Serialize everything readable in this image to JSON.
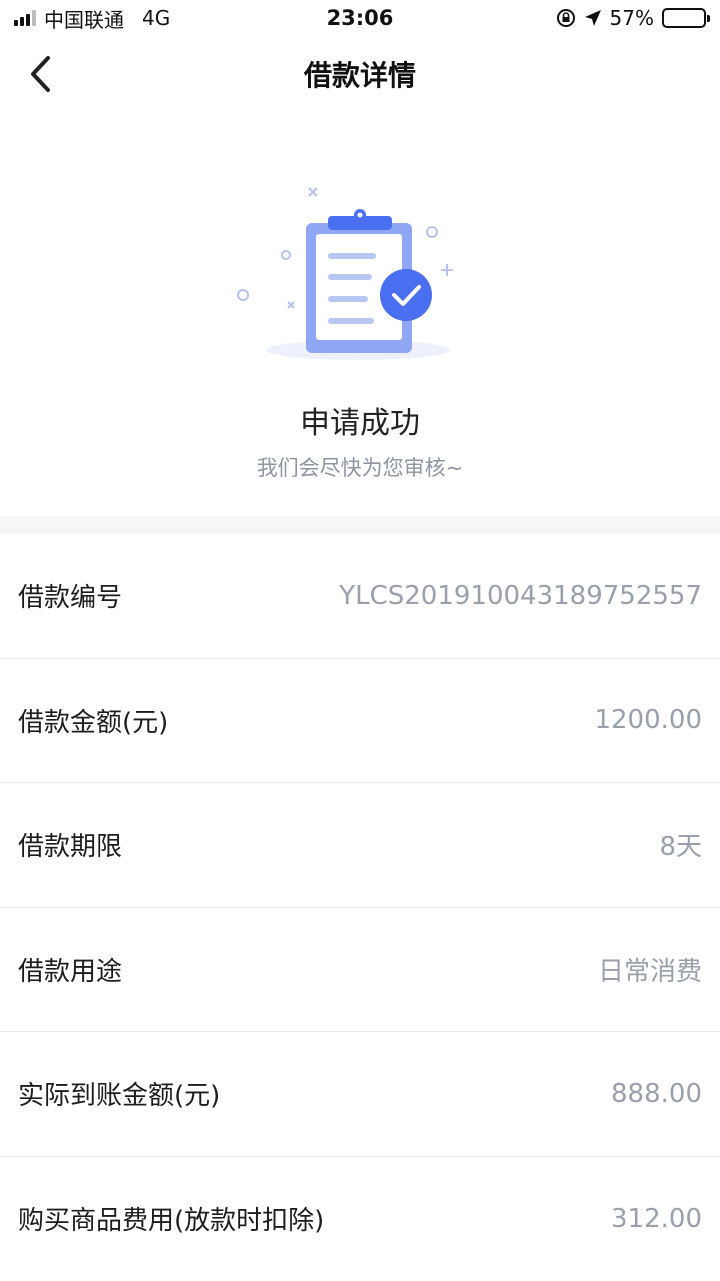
{
  "status_bar": {
    "carrier": "中国联通",
    "network": "4G",
    "time": "23:06",
    "battery": "57%",
    "battery_level": 0.57
  },
  "nav": {
    "title": "借款详情"
  },
  "hero": {
    "title": "申请成功",
    "subtitle": "我们会尽快为您审核~"
  },
  "details": [
    {
      "label": "借款编号",
      "value": "YLCS201910043189752557"
    },
    {
      "label": "借款金额(元)",
      "value": "1200.00"
    },
    {
      "label": "借款期限",
      "value": "8天"
    },
    {
      "label": "借款用途",
      "value": "日常消费"
    },
    {
      "label": "实际到账金额(元)",
      "value": "888.00"
    },
    {
      "label": "购买商品费用(放款时扣除)",
      "value": "312.00"
    }
  ],
  "colors": {
    "accent": "#4a6ff0",
    "clipboard_light": "#8fa6f5",
    "value_gray": "#9aa0ab"
  }
}
